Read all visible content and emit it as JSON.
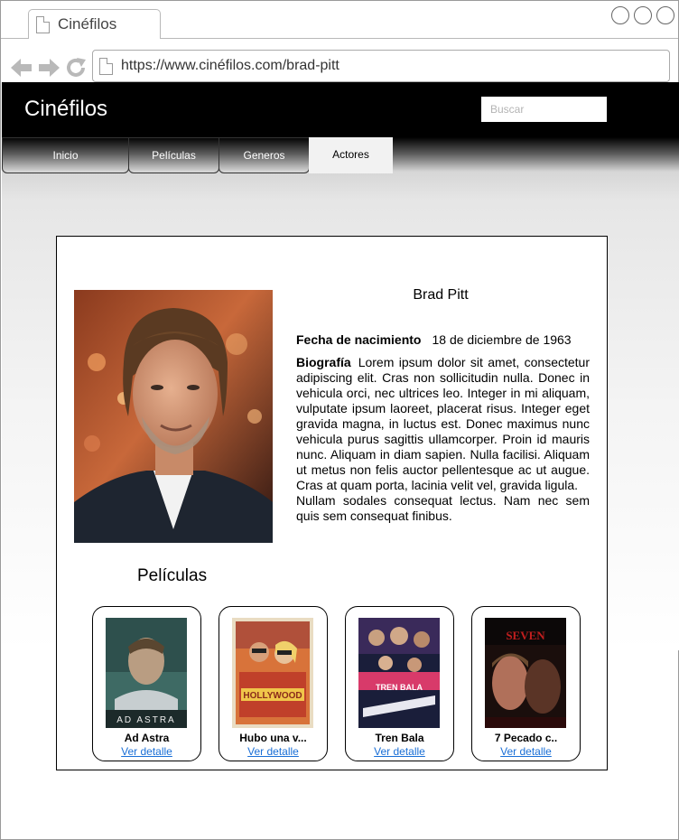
{
  "browser": {
    "tab_title": "Cinéfilos",
    "url": "https://www.cinéfilos.com/brad-pitt"
  },
  "site": {
    "title": "Cinéfilos",
    "search_placeholder": "Buscar"
  },
  "nav": {
    "tabs": [
      {
        "label": "Inicio"
      },
      {
        "label": "Películas"
      },
      {
        "label": "Generos"
      },
      {
        "label": "Actores",
        "active": true
      }
    ]
  },
  "actor": {
    "name": "Brad Pitt",
    "birth_label": "Fecha de nacimiento",
    "birth_value": "18 de diciembre de 1963",
    "bio_label": "Biografía",
    "bio_text": "Lorem ipsum dolor sit amet, consectetur adipiscing elit. Cras non sollicitudin nulla. Donec in vehicula orci, nec ultrices leo. Integer in mi aliquam, vulputate ipsum laoreet, placerat risus. Integer eget gravida magna, in luctus est. Donec maximus nunc vehicula purus sagittis ullamcorper. Proin id mauris nunc. Aliquam in diam sapien. Nulla facilisi. Aliquam ut metus non felis auctor pellentesque ac ut augue. Cras at quam porta, lacinia velit vel, gravida ligula.",
    "bio_text_2": "Nullam sodales consequat lectus. Nam nec sem quis sem consequat finibus."
  },
  "movies": {
    "heading": "Películas",
    "link_label": "Ver detalle",
    "items": [
      {
        "title": "Ad Astra",
        "poster_text": "AD ASTRA"
      },
      {
        "title": "Hubo una v...",
        "poster_text": "HOLLYWOOD"
      },
      {
        "title": "Tren Bala",
        "poster_text": "TREN BALA"
      },
      {
        "title": "7 Pecado c..",
        "poster_text": "SEVEN"
      }
    ]
  }
}
